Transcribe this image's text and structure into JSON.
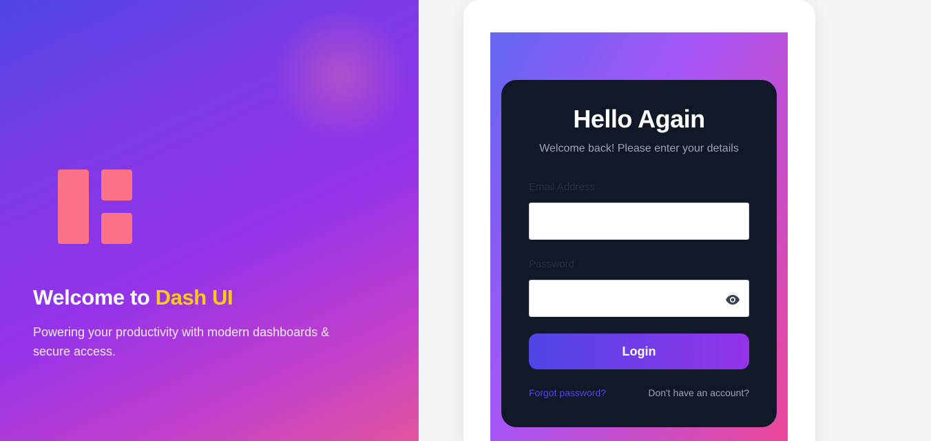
{
  "hero": {
    "welcome_prefix": "Welcome to",
    "brand_name": "Dash UI",
    "tagline": "Powering your productivity with modern dashboards & secure access.",
    "logo_icon": "dashboard-layout-icon"
  },
  "login": {
    "title": "Hello Again",
    "subtitle": "Welcome back! Please enter your details",
    "email_label": "Email Address",
    "email_value": "",
    "password_label": "Password",
    "password_value": "",
    "password_toggle_icon": "eye-icon",
    "submit_label": "Login",
    "forgot_link": "Forgot password?",
    "signup_link": "Don't have an account?"
  },
  "colors": {
    "accent": "#4f46e5",
    "brand_highlight": "#facc15",
    "logo": "#fb7185",
    "login_card_bg": "#111827"
  }
}
